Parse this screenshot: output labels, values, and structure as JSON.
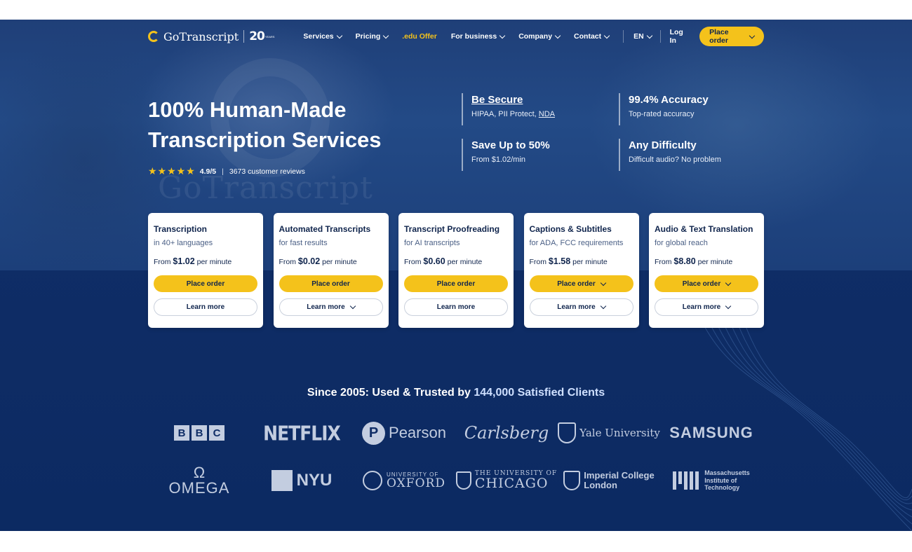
{
  "nav": {
    "brand": "GoTranscript",
    "anniversary": "20",
    "anniversary_sub": "YEARS",
    "items": [
      {
        "label": "Services",
        "dropdown": true
      },
      {
        "label": "Pricing",
        "dropdown": true
      },
      {
        "label": ".edu Offer",
        "dropdown": false
      },
      {
        "label": "For business",
        "dropdown": true
      },
      {
        "label": "Company",
        "dropdown": true
      },
      {
        "label": "Contact",
        "dropdown": true
      }
    ],
    "language": "EN",
    "login": "Log In",
    "place_order": "Place order"
  },
  "hero": {
    "title_line1": "100% Human-Made",
    "title_line2": "Transcription Services",
    "stars": "★★★★★",
    "rating": "4.9/5",
    "separator": "|",
    "reviews": "3673 customer reviews"
  },
  "features": [
    {
      "title": "Be Secure",
      "sub_prefix": "HIPAA, PII Protect, ",
      "sub_link": "NDA"
    },
    {
      "title": "99.4% Accuracy",
      "sub_prefix": "Top-rated accuracy",
      "sub_link": ""
    },
    {
      "title": "Save Up to 50%",
      "sub_prefix": "From $1.02/min",
      "sub_link": ""
    },
    {
      "title": "Any Difficulty",
      "sub_prefix": "Difficult audio? No problem",
      "sub_link": ""
    }
  ],
  "cards": [
    {
      "title": "Transcription",
      "sub": "in 40+ languages",
      "from": "From",
      "price": "$1.02",
      "unit": "per minute",
      "order": "Place order",
      "learn": "Learn more"
    },
    {
      "title": "Automated Transcripts",
      "sub": "for fast results",
      "from": "From",
      "price": "$0.02",
      "unit": "per minute",
      "order": "Place order",
      "learn": "Learn more"
    },
    {
      "title": "Transcript Proofreading",
      "sub": "for AI transcripts",
      "from": "From",
      "price": "$0.60",
      "unit": "per minute",
      "order": "Place order",
      "learn": "Learn more"
    },
    {
      "title": "Captions & Subtitles",
      "sub": "for ADA, FCC requirements",
      "from": "From",
      "price": "$1.58",
      "unit": "per minute",
      "order": "Place order",
      "learn": "Learn more"
    },
    {
      "title": "Audio & Text Translation",
      "sub": "for global reach",
      "from": "From",
      "price": "$8.80",
      "unit": "per minute",
      "order": "Place order",
      "learn": "Learn more"
    }
  ],
  "trust": {
    "prefix": "Since 2005: Used & Trusted by",
    "count": "144,000 Satisfied Clients"
  },
  "clients": {
    "bbc": [
      "B",
      "B",
      "C"
    ],
    "netflix": "NETFLIX",
    "pearson": "Pearson",
    "carlsberg": "Carlsberg",
    "yale": "Yale University",
    "samsung": "SAMSUNG",
    "omega_symbol": "Ω",
    "omega": "OMEGA",
    "nyu": "NYU",
    "oxford_top": "UNIVERSITY OF",
    "oxford": "OXFORD",
    "chicago_top": "THE UNIVERSITY OF",
    "chicago": "CHICAGO",
    "imperial_1": "Imperial College",
    "imperial_2": "London",
    "mit_1": "Massachusetts",
    "mit_2": "Institute of",
    "mit_3": "Technology"
  },
  "colors": {
    "accent": "#f4c21b",
    "navy": "#0f2d66",
    "card_text": "#10254d"
  }
}
